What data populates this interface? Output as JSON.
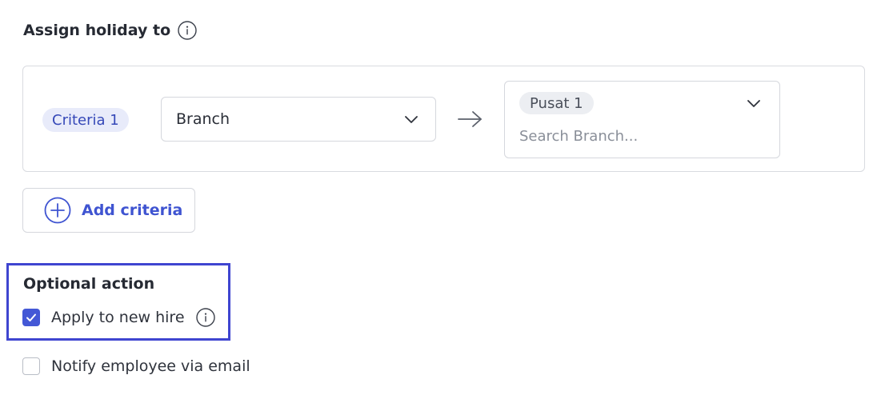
{
  "assign_section": {
    "title": "Assign holiday to"
  },
  "criteria": [
    {
      "chip_label": "Criteria 1",
      "field_value": "Branch",
      "selected_tags": [
        "Pusat 1"
      ],
      "search_placeholder": "Search Branch..."
    }
  ],
  "add_criteria": {
    "label": "Add criteria"
  },
  "optional_action": {
    "title": "Optional action",
    "options": [
      {
        "label": "Apply to new hire",
        "checked": true
      },
      {
        "label": "Notify employee via email",
        "checked": false
      }
    ]
  },
  "colors": {
    "accent": "#4458d6",
    "highlight_border": "#3f45d0",
    "chip_bg": "#e8ebfa",
    "chip_text": "#3548b8"
  },
  "icons": {
    "info": "info-circle-icon",
    "chevron": "chevron-down-icon",
    "arrow": "arrow-right-icon",
    "plus": "plus-circle-icon",
    "check": "checkmark-icon"
  }
}
